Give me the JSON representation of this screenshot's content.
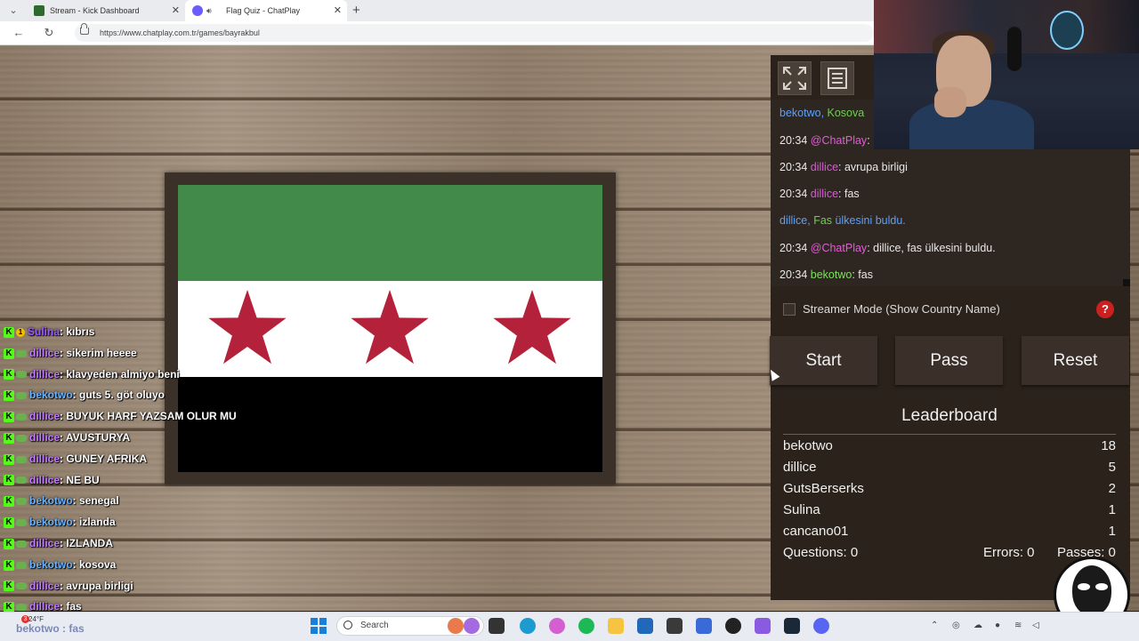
{
  "browser": {
    "tabs": [
      {
        "title": "Stream - Kick Dashboard"
      },
      {
        "title": "Flag Quiz - ChatPlay"
      }
    ],
    "url": "https://www.chatplay.com.tr/games/bayrakbul"
  },
  "flag": {
    "colors": {
      "top": "#418a4a",
      "middle": "#ffffff",
      "bottom": "#000000",
      "stars": "#b4213a"
    },
    "star_count": 3
  },
  "stream_chat": [
    {
      "user": "Sulina",
      "msg": ": kıbrıs",
      "color": "u-violet",
      "badge": "coin"
    },
    {
      "user": "dillice",
      "msg": ": sikerim heeee",
      "color": "u-purple"
    },
    {
      "user": "dillice",
      "msg": ": klavyeden almiyo beni",
      "color": "u-purple"
    },
    {
      "user": "bekotwo",
      "msg": ": guts 5. göt oluyo",
      "color": "u-blue"
    },
    {
      "user": "dillice",
      "msg": ": BUYUK HARF YAZSAM OLUR MU",
      "color": "u-purple"
    },
    {
      "user": "dillice",
      "msg": ": AVUSTURYA",
      "color": "u-purple"
    },
    {
      "user": "dillice",
      "msg": ": GUNEY AFRIKA",
      "color": "u-purple"
    },
    {
      "user": "dillice",
      "msg": ": NE BU",
      "color": "u-purple"
    },
    {
      "user": "bekotwo",
      "msg": ": senegal",
      "color": "u-blue"
    },
    {
      "user": "bekotwo",
      "msg": ": izlanda",
      "color": "u-blue"
    },
    {
      "user": "dillice",
      "msg": ": IZLANDA",
      "color": "u-purple"
    },
    {
      "user": "bekotwo",
      "msg": ": kosova",
      "color": "u-blue"
    },
    {
      "user": "dillice",
      "msg": ": avrupa birligi",
      "color": "u-purple"
    },
    {
      "user": "dillice",
      "msg": ": fas",
      "color": "u-purple"
    }
  ],
  "stream_chat_bottom": "bekotwo : fas",
  "game_chat": {
    "line1": {
      "name": "bekotwo",
      "sep": ", ",
      "country": "Kosova"
    },
    "line2": {
      "time": "20:34",
      "user": "@ChatPlay",
      "text": ":"
    },
    "line3": {
      "time": "20:34",
      "user": "dillice",
      "text": ": avrupa birligi"
    },
    "line4": {
      "time": "20:34",
      "user": "dillice",
      "text": ": fas"
    },
    "line5": {
      "name": "dillice",
      "sep": ", ",
      "country": "Fas",
      "text": " ülkesini buldu."
    },
    "line6": {
      "time": "20:34",
      "user": "@ChatPlay",
      "text": ": dillice, fas ülkesini buldu."
    },
    "line7": {
      "time": "20:34",
      "user": "bekotwo",
      "text": ": fas"
    }
  },
  "controls": {
    "streamer_mode_label": "Streamer Mode (Show Country Name)",
    "help": "?",
    "start": "Start",
    "pass": "Pass",
    "reset": "Reset"
  },
  "leaderboard": {
    "title": "Leaderboard",
    "rows": [
      {
        "name": "bekotwo",
        "score": "18"
      },
      {
        "name": "dillice",
        "score": "5"
      },
      {
        "name": "GutsBerserks",
        "score": "2"
      },
      {
        "name": "Sulina",
        "score": "1"
      },
      {
        "name": "cancano01",
        "score": "1"
      }
    ],
    "questions": "Questions: 0",
    "errors": "Errors: 0",
    "passes": "Passes: 0"
  },
  "taskbar": {
    "weather": "24°F",
    "weather_badge": "3",
    "search": "Search"
  }
}
